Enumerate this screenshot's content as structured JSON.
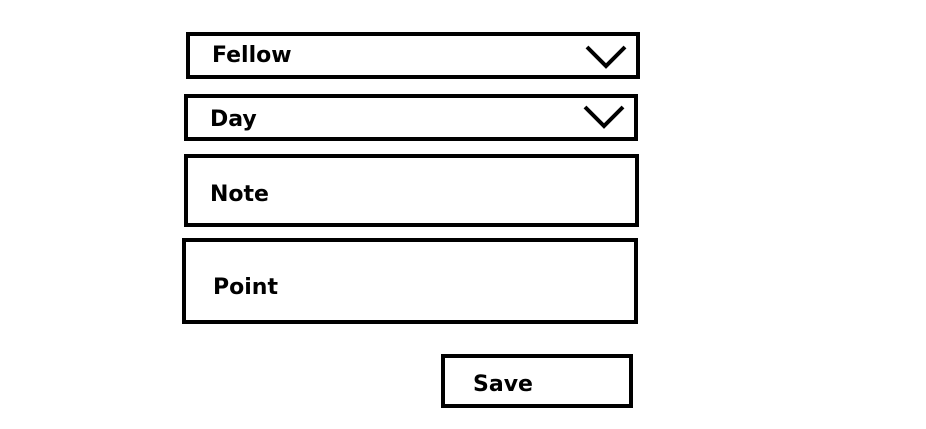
{
  "form": {
    "fellow_select": {
      "value": "Fellow",
      "icon": "chevron-down-icon"
    },
    "day_select": {
      "value": "Day",
      "icon": "chevron-down-icon"
    },
    "note_field": {
      "value": "Note"
    },
    "point_field": {
      "value": "Point"
    },
    "save_button": {
      "label": "Save"
    }
  },
  "colors": {
    "border": "#000000",
    "background": "#ffffff",
    "text": "#000000"
  }
}
